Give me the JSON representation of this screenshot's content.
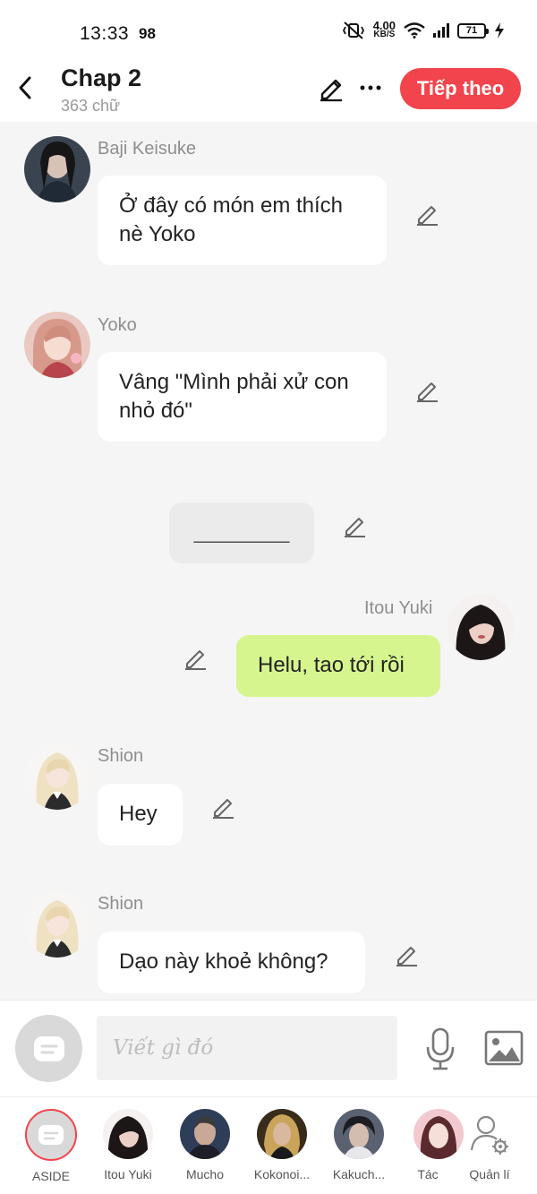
{
  "status_bar": {
    "time": "13:33",
    "notification_count": "98",
    "net_speed_value": "4.00",
    "net_speed_unit": "KB/S",
    "battery": "71"
  },
  "header": {
    "title": "Chap 2",
    "subtitle": "363 chữ",
    "next_label": "Tiếp theo"
  },
  "messages": [
    {
      "sender": "Baji Keisuke",
      "text": "Ở đây có món em thích nè Yoko",
      "side": "left"
    },
    {
      "sender": "Yoko",
      "text": "Vâng \"Mình phải xử con nhỏ đó\"",
      "side": "left"
    },
    {
      "sender": "",
      "text": "________",
      "side": "center"
    },
    {
      "sender": "Itou Yuki",
      "text": "Helu, tao tới rồi",
      "side": "right"
    },
    {
      "sender": "Shion",
      "text": "Hey",
      "side": "left"
    },
    {
      "sender": "Shion",
      "text": "Dạo này khoẻ không?",
      "side": "left"
    }
  ],
  "composer": {
    "placeholder": "Viết gì đó"
  },
  "characters": [
    {
      "name": "ASIDE"
    },
    {
      "name": "Itou Yuki"
    },
    {
      "name": "Mucho"
    },
    {
      "name": "Kokonoi..."
    },
    {
      "name": "Kakuch..."
    },
    {
      "name": "Tác"
    },
    {
      "name": "Quản lí"
    }
  ],
  "colors": {
    "accent": "#f2444c",
    "my_bubble": "#d6f58e",
    "background": "#f5f5f5"
  }
}
